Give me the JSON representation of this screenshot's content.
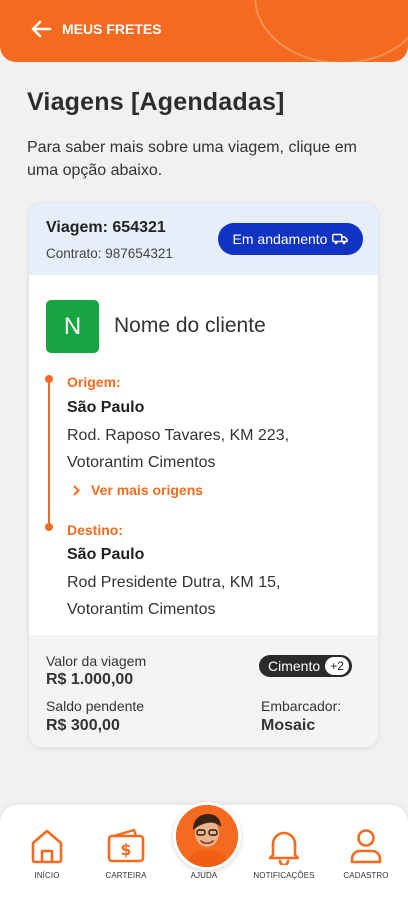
{
  "header": {
    "back_label": "MEUS FRETES"
  },
  "page": {
    "title": "Viagens [Agendadas]",
    "subtitle": "Para saber mais sobre uma viagem, clique em uma opção abaixo."
  },
  "trip": {
    "id_label": "Viagem: 654321",
    "contract_label": "Contrato: 987654321",
    "status": "Em andamento",
    "client_initial": "N",
    "client_name": "Nome do cliente",
    "origin": {
      "label": "Origem:",
      "city": "São Paulo",
      "address_line1": "Rod. Raposo Tavares, KM 223,",
      "address_line2": "Votorantim Cimentos"
    },
    "more_origins": "Ver mais origens",
    "destination": {
      "label": "Destino:",
      "city": "São Paulo",
      "address_line1": "Rod Presidente Dutra, KM 15,",
      "address_line2": "Votorantim Cimentos"
    },
    "trip_value_label": "Valor da viagem",
    "trip_value": "R$ 1.000,00",
    "pending_label": "Saldo pendente",
    "pending_value": "R$ 300,00",
    "cargo": "Cimento",
    "cargo_extra": "+2",
    "shipper_label": "Embarcador:",
    "shipper_name": "Mosaic"
  },
  "nav": {
    "items": [
      {
        "label": "INÍCIO",
        "icon": "home-icon"
      },
      {
        "label": "CARTEIRA",
        "icon": "wallet-icon"
      },
      {
        "label": "AJUDA",
        "icon": "help-avatar"
      },
      {
        "label": "NOTIFICAÇÕES",
        "icon": "bell-icon"
      },
      {
        "label": "CADASTRO",
        "icon": "user-icon"
      }
    ]
  },
  "colors": {
    "accent": "#f46b1f",
    "status": "#1133c4",
    "client_badge": "#17a541"
  }
}
